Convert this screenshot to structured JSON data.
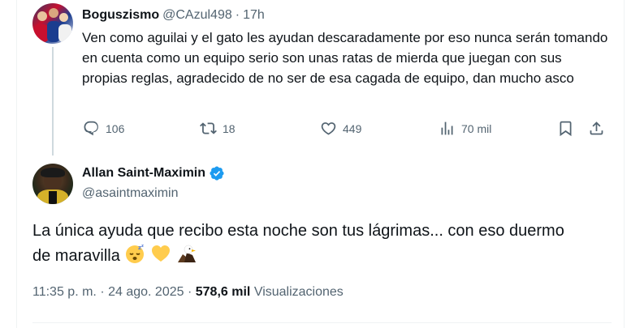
{
  "reply_tweet": {
    "display_name": "Boguszismo",
    "handle": "@CAzul498",
    "separator": "·",
    "time": "17h",
    "text": "Ven como aguilai y el gato les ayudan descaradamente por eso nunca serán tomando en cuenta como un equipo serio son unas ratas de mierda que juegan con sus propias reglas, agradecido de no ser de esa cagada de equipo, dan mucho asco",
    "actions": {
      "replies": "106",
      "reposts": "18",
      "likes": "449",
      "views": "70 mil"
    }
  },
  "main_tweet": {
    "display_name": "Allan Saint-Maximin",
    "verified": true,
    "handle": "@asaintmaximin",
    "text_line1": "La única ayuda que recibo esta noche son tus lágrimas... con eso duermo",
    "text_line2": "de maravilla",
    "emojis": [
      "sleeping-face",
      "yellow-heart",
      "eagle"
    ],
    "time": "11:35 p. m.",
    "separator": "·",
    "date": "24 ago. 2025",
    "views_count": "578,6 mil",
    "views_label": "Visualizaciones"
  },
  "colors": {
    "text_primary": "#0f1419",
    "text_secondary": "#536471",
    "verified_blue": "#1d9bf0",
    "thread_line": "#cfd9de"
  }
}
